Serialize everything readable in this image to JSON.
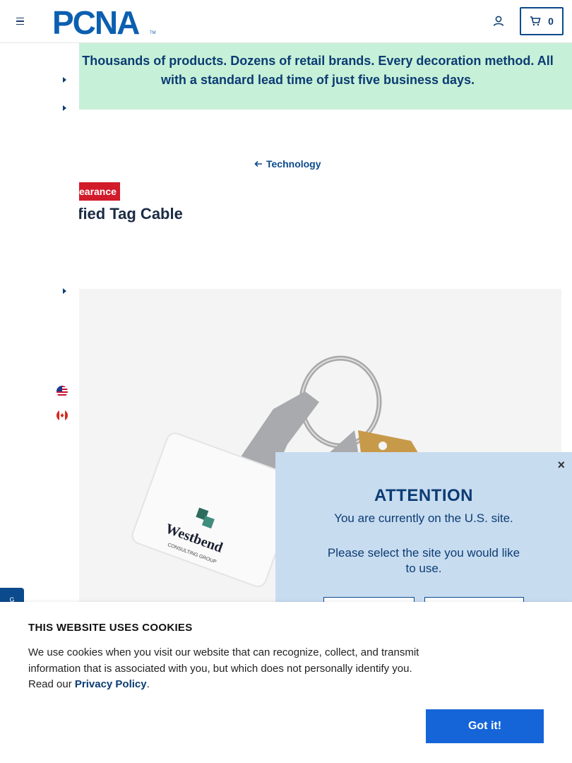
{
  "header": {
    "logo_text": "PCNA",
    "logo_tm": "TM",
    "cart_count": "0",
    "brand_color": "#0b4a8c"
  },
  "banner": {
    "text": "Thousands of products. Dozens of retail brands. Every decoration method. All with a standard lead time of just five business days.",
    "background": "#c7f0d8"
  },
  "breadcrumb": {
    "label": "Technology"
  },
  "product": {
    "badge": "Clearance",
    "badge_visible": "earance",
    "title_visible": "ified Tag Cable",
    "image_logo_line1": "Westbend",
    "image_logo_line2": "CONSULTING GROUP"
  },
  "modal": {
    "title": "ATTENTION",
    "line1": "You are currently on the U.S. site.",
    "line2": "Please select the site you would like to use.",
    "close": "×"
  },
  "cookie": {
    "title": "THIS WEBSITE USES COOKIES",
    "text_before": "We use cookies when you visit our website that can recognize, collect, and transmit information that is associated with you, but which does not personally identify you. Read our ",
    "link": "Privacy Policy",
    "text_after": ".",
    "button": "Got it!"
  },
  "feedback_tab": {
    "label": "G"
  }
}
